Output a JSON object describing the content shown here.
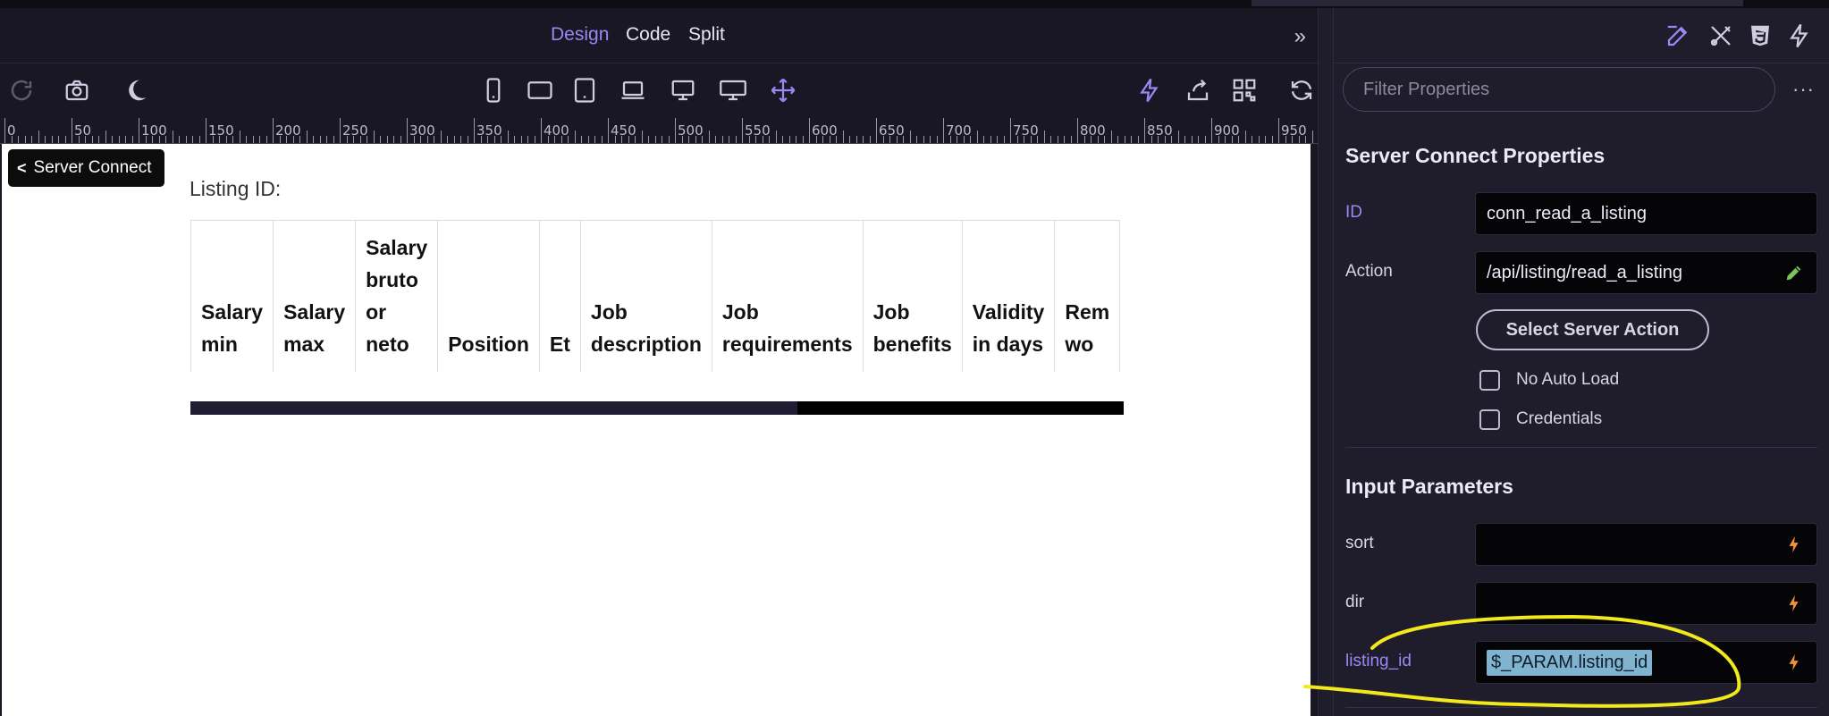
{
  "view_tabs": {
    "design": "Design",
    "code": "Code",
    "split": "Split",
    "expand_icon": "double-chevron-right-icon"
  },
  "toolbar": {
    "icons": [
      "redo-icon",
      "camera-icon",
      "moon-icon",
      "phone-icon",
      "tablet-landscape-icon",
      "tablet-icon",
      "laptop-icon",
      "desktop-icon",
      "wide-desktop-icon",
      "move-icon",
      "lightning-icon",
      "share-icon",
      "qr-code-icon",
      "refresh-icon"
    ]
  },
  "ruler": {
    "labels": [
      "0",
      "50",
      "100",
      "150",
      "200",
      "250",
      "300",
      "350",
      "400",
      "450",
      "500",
      "550",
      "600",
      "650",
      "700",
      "750",
      "800",
      "850",
      "900",
      "950"
    ]
  },
  "canvas": {
    "badge": "Server Connect",
    "listing_label": "Listing ID:",
    "table_headers": [
      [
        "Salary",
        "min"
      ],
      [
        "Salary",
        "max"
      ],
      [
        "Salary",
        "bruto",
        "or",
        "neto"
      ],
      [
        "Position"
      ],
      [
        "Et"
      ],
      [
        "Job",
        "description"
      ],
      [
        "Job",
        "requirements"
      ],
      [
        "Job",
        "benefits"
      ],
      [
        "Validity",
        "in days"
      ],
      [
        "Rem",
        "wo"
      ]
    ],
    "scroll_position": 0.65
  },
  "panel": {
    "head_icons": [
      "edit-icon",
      "tools-icon",
      "css3-icon",
      "lightning-icon"
    ],
    "filter_placeholder": "Filter Properties",
    "more": "···",
    "section1": "Server Connect Properties",
    "id_label": "ID",
    "id_value": "conn_read_a_listing",
    "action_label": "Action",
    "action_value": "/api/listing/read_a_listing",
    "select_button": "Select Server Action",
    "no_auto_load": "No Auto Load",
    "credentials": "Credentials",
    "section2": "Input Parameters",
    "params": [
      {
        "label": "sort",
        "value": ""
      },
      {
        "label": "dir",
        "value": ""
      },
      {
        "label": "listing_id",
        "value": "$_PARAM.listing_id"
      }
    ]
  },
  "colors": {
    "accent": "#9b87f5",
    "lightning": "#f0923a",
    "highlight": "#f2e81c",
    "token_bg": "#7fb3cf"
  }
}
